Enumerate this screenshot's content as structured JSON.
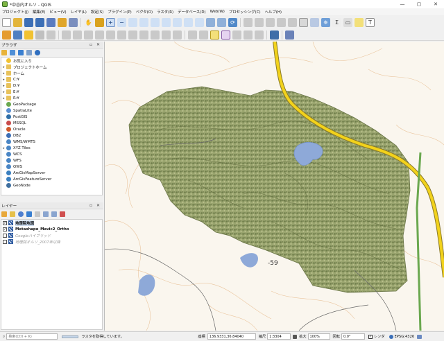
{
  "window": {
    "title": "*中谷内オルソ - QGIS",
    "minimize": "—",
    "maximize": "▢",
    "close": "✕"
  },
  "menu": [
    "プロジェクト(J)",
    "編集(E)",
    "ビュー(V)",
    "レイヤ(L)",
    "設定(S)",
    "プラグイン(P)",
    "ベクタ(O)",
    "ラスタ(R)",
    "データベース(D)",
    "Web(W)",
    "プロセッシング(C)",
    "ヘルプ(H)"
  ],
  "colors": {
    "accent": "#2d5aa0",
    "road": "#f2d21b",
    "water": "#8ea9d8",
    "ortho": "#8f9a6a"
  },
  "browser": {
    "title": "ブラウザ",
    "items": [
      {
        "label": "お気に入り",
        "icon": "star-icon",
        "expand": false
      },
      {
        "label": "プロジェクトホーム",
        "icon": "folder-icon",
        "expand": true
      },
      {
        "label": "ホーム",
        "icon": "folder-icon",
        "expand": true
      },
      {
        "label": "C:¥",
        "icon": "folder-icon",
        "expand": true
      },
      {
        "label": "D:¥",
        "icon": "folder-icon",
        "expand": true
      },
      {
        "label": "E:¥",
        "icon": "folder-icon",
        "expand": true
      },
      {
        "label": "R:¥",
        "icon": "folder-icon",
        "expand": true
      },
      {
        "label": "GeoPackage",
        "icon": "geopackage-icon",
        "expand": false
      },
      {
        "label": "SpatiaLite",
        "icon": "spatialite-icon",
        "expand": false
      },
      {
        "label": "PostGIS",
        "icon": "postgis-icon",
        "expand": false
      },
      {
        "label": "MSSQL",
        "icon": "mssql-icon",
        "expand": false
      },
      {
        "label": "Oracle",
        "icon": "oracle-icon",
        "expand": false
      },
      {
        "label": "DB2",
        "icon": "db2-icon",
        "expand": false
      },
      {
        "label": "WMS/WMTS",
        "icon": "wms-icon",
        "expand": false
      },
      {
        "label": "XYZ Tiles",
        "icon": "xyz-icon",
        "expand": true
      },
      {
        "label": "WCS",
        "icon": "wcs-icon",
        "expand": false
      },
      {
        "label": "WFS",
        "icon": "wfs-icon",
        "expand": false
      },
      {
        "label": "OWS",
        "icon": "ows-icon",
        "expand": false
      },
      {
        "label": "ArcGisMapServer",
        "icon": "arcgis-icon",
        "expand": false
      },
      {
        "label": "ArcGisFeatureServer",
        "icon": "arcgis-icon",
        "expand": false
      },
      {
        "label": "GeoNode",
        "icon": "geonode-icon",
        "expand": false
      }
    ]
  },
  "layers": {
    "title": "レイヤー",
    "items": [
      {
        "label": "地理院地図",
        "checked": true,
        "bold": true,
        "muted": false
      },
      {
        "label": "Metashape_Mavic2_Ortho",
        "checked": true,
        "bold": true,
        "muted": false
      },
      {
        "label": "Googleハイブリッド",
        "checked": false,
        "bold": false,
        "muted": true
      },
      {
        "label": "地理院オルソ_2007年以降",
        "checked": false,
        "bold": false,
        "muted": true
      }
    ]
  },
  "map": {
    "label": "-59"
  },
  "status": {
    "search_placeholder": "検索(Ctrl + K)",
    "message": "ラスタを取得しています。",
    "coord_label": "座標",
    "coord_value": "136.9331,36.84040",
    "scale_label": "縮尺",
    "scale_value": "1:3304",
    "magnifier_label": "拡大",
    "magnifier_value": "100%",
    "rotation_label": "回転",
    "rotation_value": "0.0°",
    "render_label": "レンダ",
    "crs": "EPSG:4326"
  }
}
